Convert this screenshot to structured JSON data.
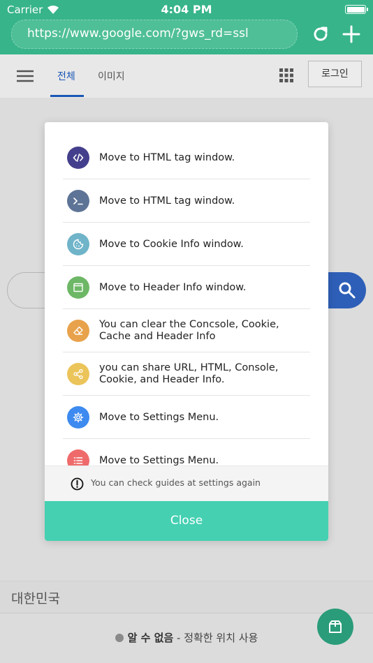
{
  "status_bar": {
    "carrier": "Carrier",
    "time": "4:04 PM"
  },
  "url_bar": {
    "url": "https://www.google.com/?gws_rd=ssl"
  },
  "google": {
    "tab_all": "전체",
    "tab_images": "이미지",
    "login": "로그인",
    "country": "대한민국",
    "location_unknown": "알 수 없음",
    "location_separator": " - ",
    "location_action": "정확한 위치 사용"
  },
  "modal": {
    "items": [
      {
        "text": "Move to HTML tag window.",
        "icon": "code-icon",
        "color": "#443f8c"
      },
      {
        "text": "Move to HTML tag window.",
        "icon": "terminal-icon",
        "color": "#5e7496"
      },
      {
        "text": "Move to Cookie Info window.",
        "icon": "cookie-icon",
        "color": "#6fb4c9"
      },
      {
        "text": "Move to Header Info window.",
        "icon": "window-icon",
        "color": "#6db766"
      },
      {
        "text": "You can clear the Concsole, Cookie, Cache and Header Info",
        "icon": "eraser-icon",
        "color": "#e8a24b"
      },
      {
        "text": "you can share URL, HTML, Console, Cookie, and Header Info.",
        "icon": "share-icon",
        "color": "#ebc45a"
      },
      {
        "text": "Move to Settings Menu.",
        "icon": "gear-icon",
        "color": "#3d8af0"
      },
      {
        "text": "Move to Settings Menu.",
        "icon": "list-icon",
        "color": "#ef6b6b"
      }
    ],
    "note": "You can check guides at settings again",
    "close_label": "Close"
  },
  "colors": {
    "brand": "#37b48a",
    "accent": "#45d0b2",
    "google_blue": "#2e5fb8"
  }
}
